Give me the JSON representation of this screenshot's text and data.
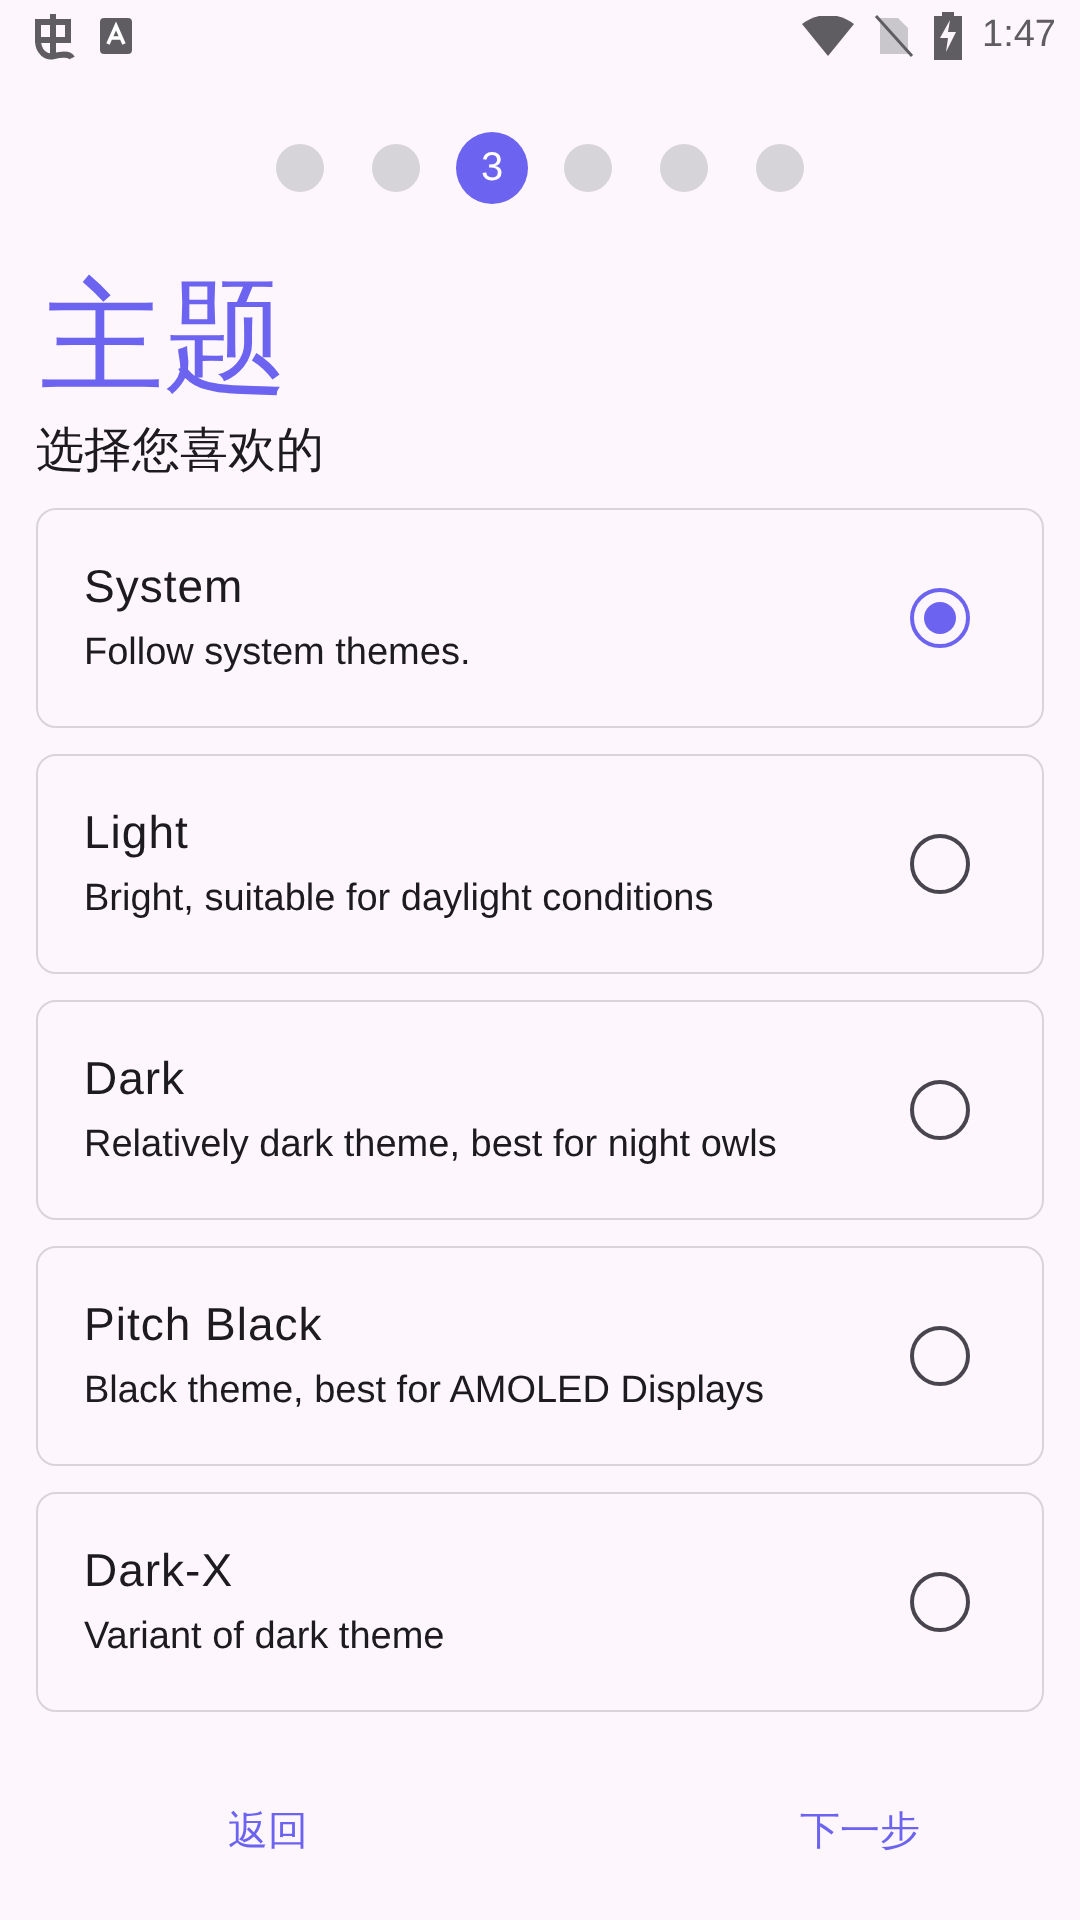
{
  "status_bar": {
    "time": "1:47"
  },
  "steps": [
    {
      "selected": false
    },
    {
      "selected": false
    },
    {
      "label": "3",
      "selected": true
    },
    {
      "selected": false
    },
    {
      "selected": false
    },
    {
      "selected": false
    }
  ],
  "title": "主题",
  "subtitle": "选择您喜欢的",
  "themes": [
    {
      "name": "System",
      "description": "Follow system themes.",
      "selected": true
    },
    {
      "name": "Light",
      "description": "Bright, suitable for daylight conditions",
      "selected": false
    },
    {
      "name": "Dark",
      "description": "Relatively dark theme, best for night owls",
      "selected": false
    },
    {
      "name": "Pitch Black",
      "description": "Black theme, best for AMOLED Displays",
      "selected": false
    },
    {
      "name": "Dark-X",
      "description": "Variant of dark theme",
      "selected": false
    }
  ],
  "buttons": {
    "back": "返回",
    "next": "下一步"
  }
}
